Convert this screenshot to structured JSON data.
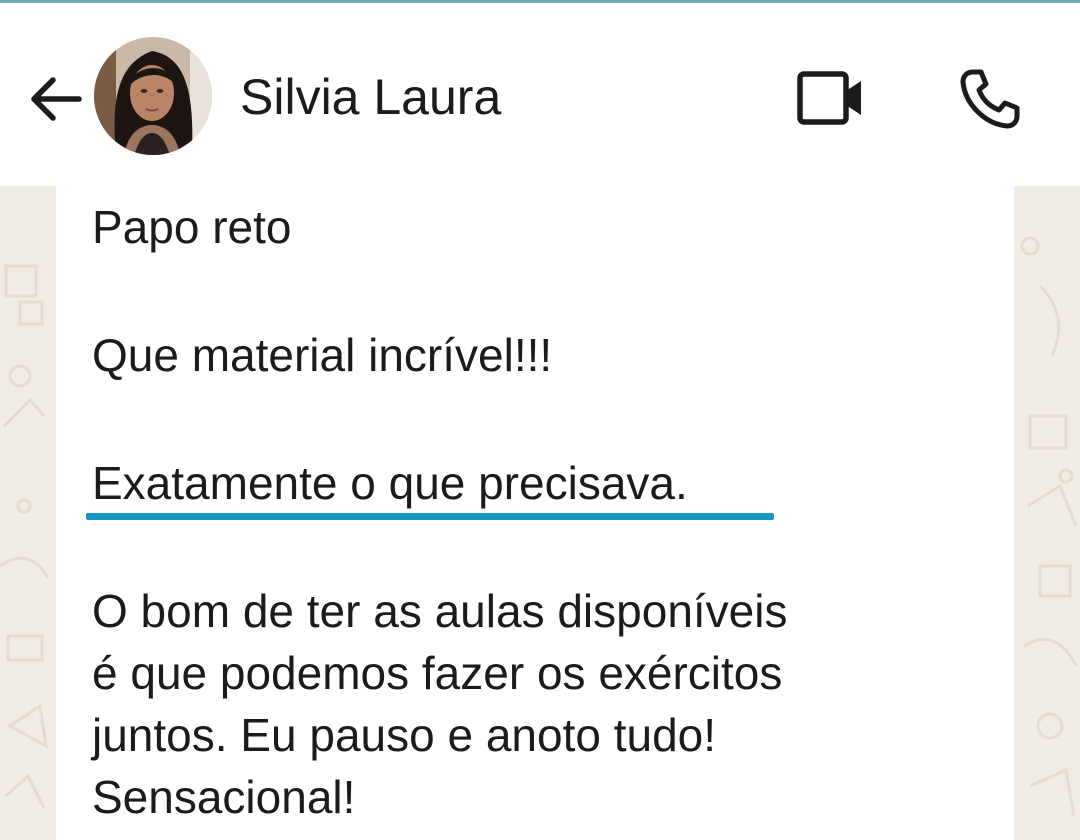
{
  "header": {
    "contact_name": "Silvia Laura",
    "back_icon": "arrow-left-icon",
    "video_icon": "video-camera-icon",
    "call_icon": "phone-icon"
  },
  "message": {
    "line1": "Papo reto",
    "line2": "Que material incrível!!!",
    "line3": "Exatamente o que precisava.",
    "paragraph": [
      "O bom de ter as aulas disponíveis",
      "é que podemos fazer os exércitos",
      "juntos. Eu pauso e anoto tudo!",
      "Sensacional!"
    ]
  },
  "colors": {
    "header_bg": "#ffffff",
    "chat_bg": "#f1ece4",
    "bubble_bg": "#ffffff",
    "highlight_underline": "#1897c4",
    "text": "#1b1b1b"
  }
}
